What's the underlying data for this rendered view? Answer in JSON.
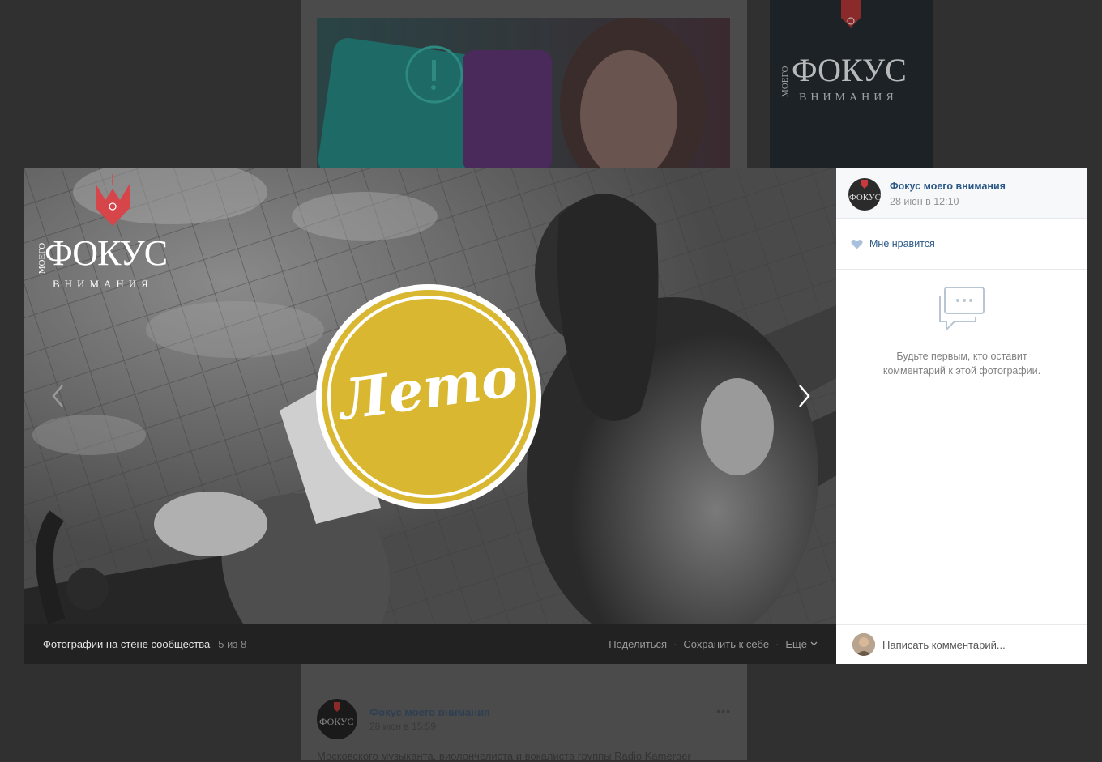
{
  "viewer": {
    "brand": {
      "top": "МОЕГО",
      "main": "ФОКУС",
      "sub": "ВНИМАНИЯ"
    },
    "badge_text": "Лето",
    "bottom_bar": {
      "album_title": "Фотографии на стене сообщества",
      "counter": "5 из 8",
      "share": "Поделиться",
      "save": "Сохранить к себе",
      "more": "Ещё"
    }
  },
  "side": {
    "author": "Фокус моего внимания",
    "date": "28 июн в 12:10",
    "like": "Мне нравится",
    "empty_line1": "Будьте первым, кто оставит",
    "empty_line2": "комментарий к этой фотографии.",
    "comment_placeholder": "Написать комментарий..."
  },
  "feed": {
    "post2": {
      "author": "Фокус моего внимания",
      "date": "28 июн в 15:59",
      "text": "Московского музыканта, виолончелиста и вокалиста группы Radio Kamerger",
      "avatar_text": "ФОКУС"
    },
    "side_brand": {
      "main": "ФОКУС",
      "sub": "ВНИМАНИЯ",
      "top": "МОЕГО"
    }
  },
  "colors": {
    "badge": "#d9b730",
    "accent_link": "#2a5885",
    "brand_red": "#e0464a"
  }
}
